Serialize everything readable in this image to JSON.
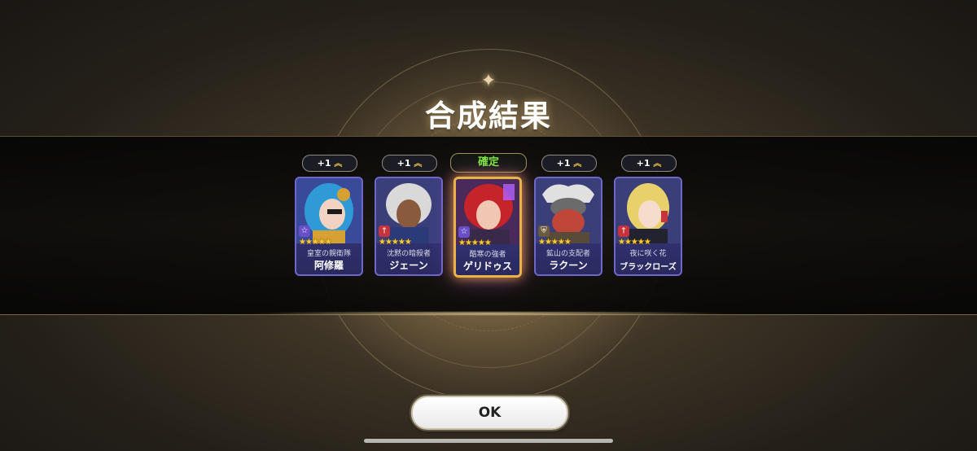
{
  "title": "合成結果",
  "confirm_label": "確定",
  "ok_label": "OK",
  "plus_badge": "+1",
  "cards": [
    {
      "epithet": "皇室の親衛隊",
      "name": "阿修羅",
      "stars": 5,
      "class_icon": "star-icon",
      "hair": "#2f9ad6",
      "skin": "#f2d3c1",
      "outfit": "#d6a032"
    },
    {
      "epithet": "沈黙の暗殺者",
      "name": "ジェーン",
      "stars": 5,
      "class_icon": "dagger-icon",
      "hair": "#d9d9d9",
      "skin": "#8a5a3c",
      "outfit": "#2b3a78"
    },
    {
      "epithet": "酷寒の強者",
      "name": "ゲリドゥス",
      "stars": 5,
      "class_icon": "star-icon",
      "hair": "#c4242a",
      "skin": "#f0c7b3",
      "outfit": "#3a2a4a"
    },
    {
      "epithet": "鉱山の支配者",
      "name": "ラクーン",
      "stars": 5,
      "class_icon": "shield-icon",
      "hair": "#6b6b6b",
      "skin": "#c0463a",
      "outfit": "#5a4a3a"
    },
    {
      "epithet": "夜に咲く花",
      "name": "ブラックローズ",
      "stars": 5,
      "class_icon": "dagger-icon",
      "hair": "#e8d06a",
      "skin": "#f5dccd",
      "outfit": "#222230"
    }
  ]
}
